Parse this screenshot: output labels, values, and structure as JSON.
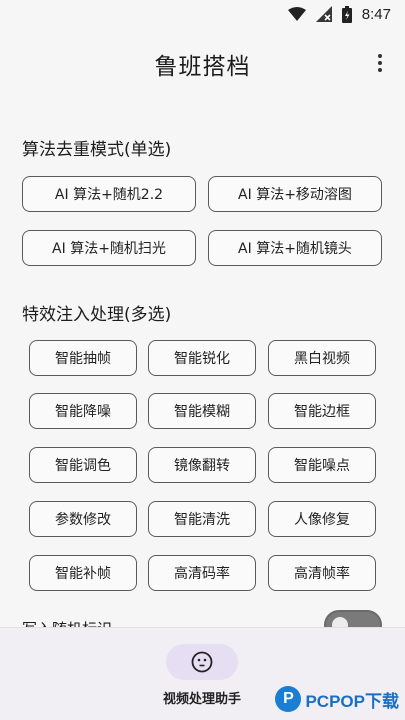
{
  "status_bar": {
    "time": "8:47"
  },
  "app_bar": {
    "title": "鲁班搭档"
  },
  "mode_section": {
    "title": "算法去重模式(单选)",
    "options": [
      "AI 算法+随机2.2",
      "AI 算法+移动溶图",
      "AI 算法+随机扫光",
      "AI 算法+随机镜头"
    ]
  },
  "effects_section": {
    "title": "特效注入处理(多选)",
    "options": [
      "智能抽帧",
      "智能锐化",
      "黑白视频",
      "智能降噪",
      "智能模糊",
      "智能边框",
      "智能调色",
      "镜像翻转",
      "智能噪点",
      "参数修改",
      "智能清洗",
      "人像修复",
      "智能补帧",
      "高清码率",
      "高清帧率"
    ]
  },
  "toggle_row": {
    "label": "写入随机标识",
    "enabled": true
  },
  "bottom_nav": {
    "items": [
      {
        "label": "视频处理助手",
        "icon": "face-icon",
        "selected": true
      }
    ]
  },
  "watermark": {
    "logo_letter": "P",
    "text": "PCPOP下载"
  }
}
